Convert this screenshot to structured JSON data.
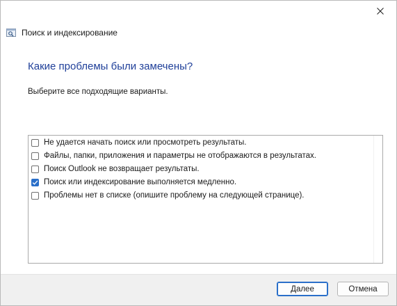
{
  "window": {
    "title": "Поиск и индексирование",
    "close_icon": "close-icon",
    "app_icon": "search-settings-icon"
  },
  "main": {
    "heading": "Какие проблемы были замечены?",
    "instruction": "Выберите все подходящие варианты."
  },
  "options": [
    {
      "label": "Не удается начать поиск или просмотреть результаты.",
      "checked": false
    },
    {
      "label": "Файлы, папки, приложения и параметры не отображаются в результатах.",
      "checked": false
    },
    {
      "label": "Поиск Outlook не возвращает результаты.",
      "checked": false
    },
    {
      "label": "Поиск или индексирование выполняется медленно.",
      "checked": true
    },
    {
      "label": "Проблемы нет в списке (опишите проблему на следующей странице).",
      "checked": false
    }
  ],
  "footer": {
    "next_label": "Далее",
    "cancel_label": "Отмена"
  },
  "colors": {
    "heading": "#1f3f99",
    "accent": "#2a6fc9",
    "footer_bg": "#f0f0f0"
  }
}
